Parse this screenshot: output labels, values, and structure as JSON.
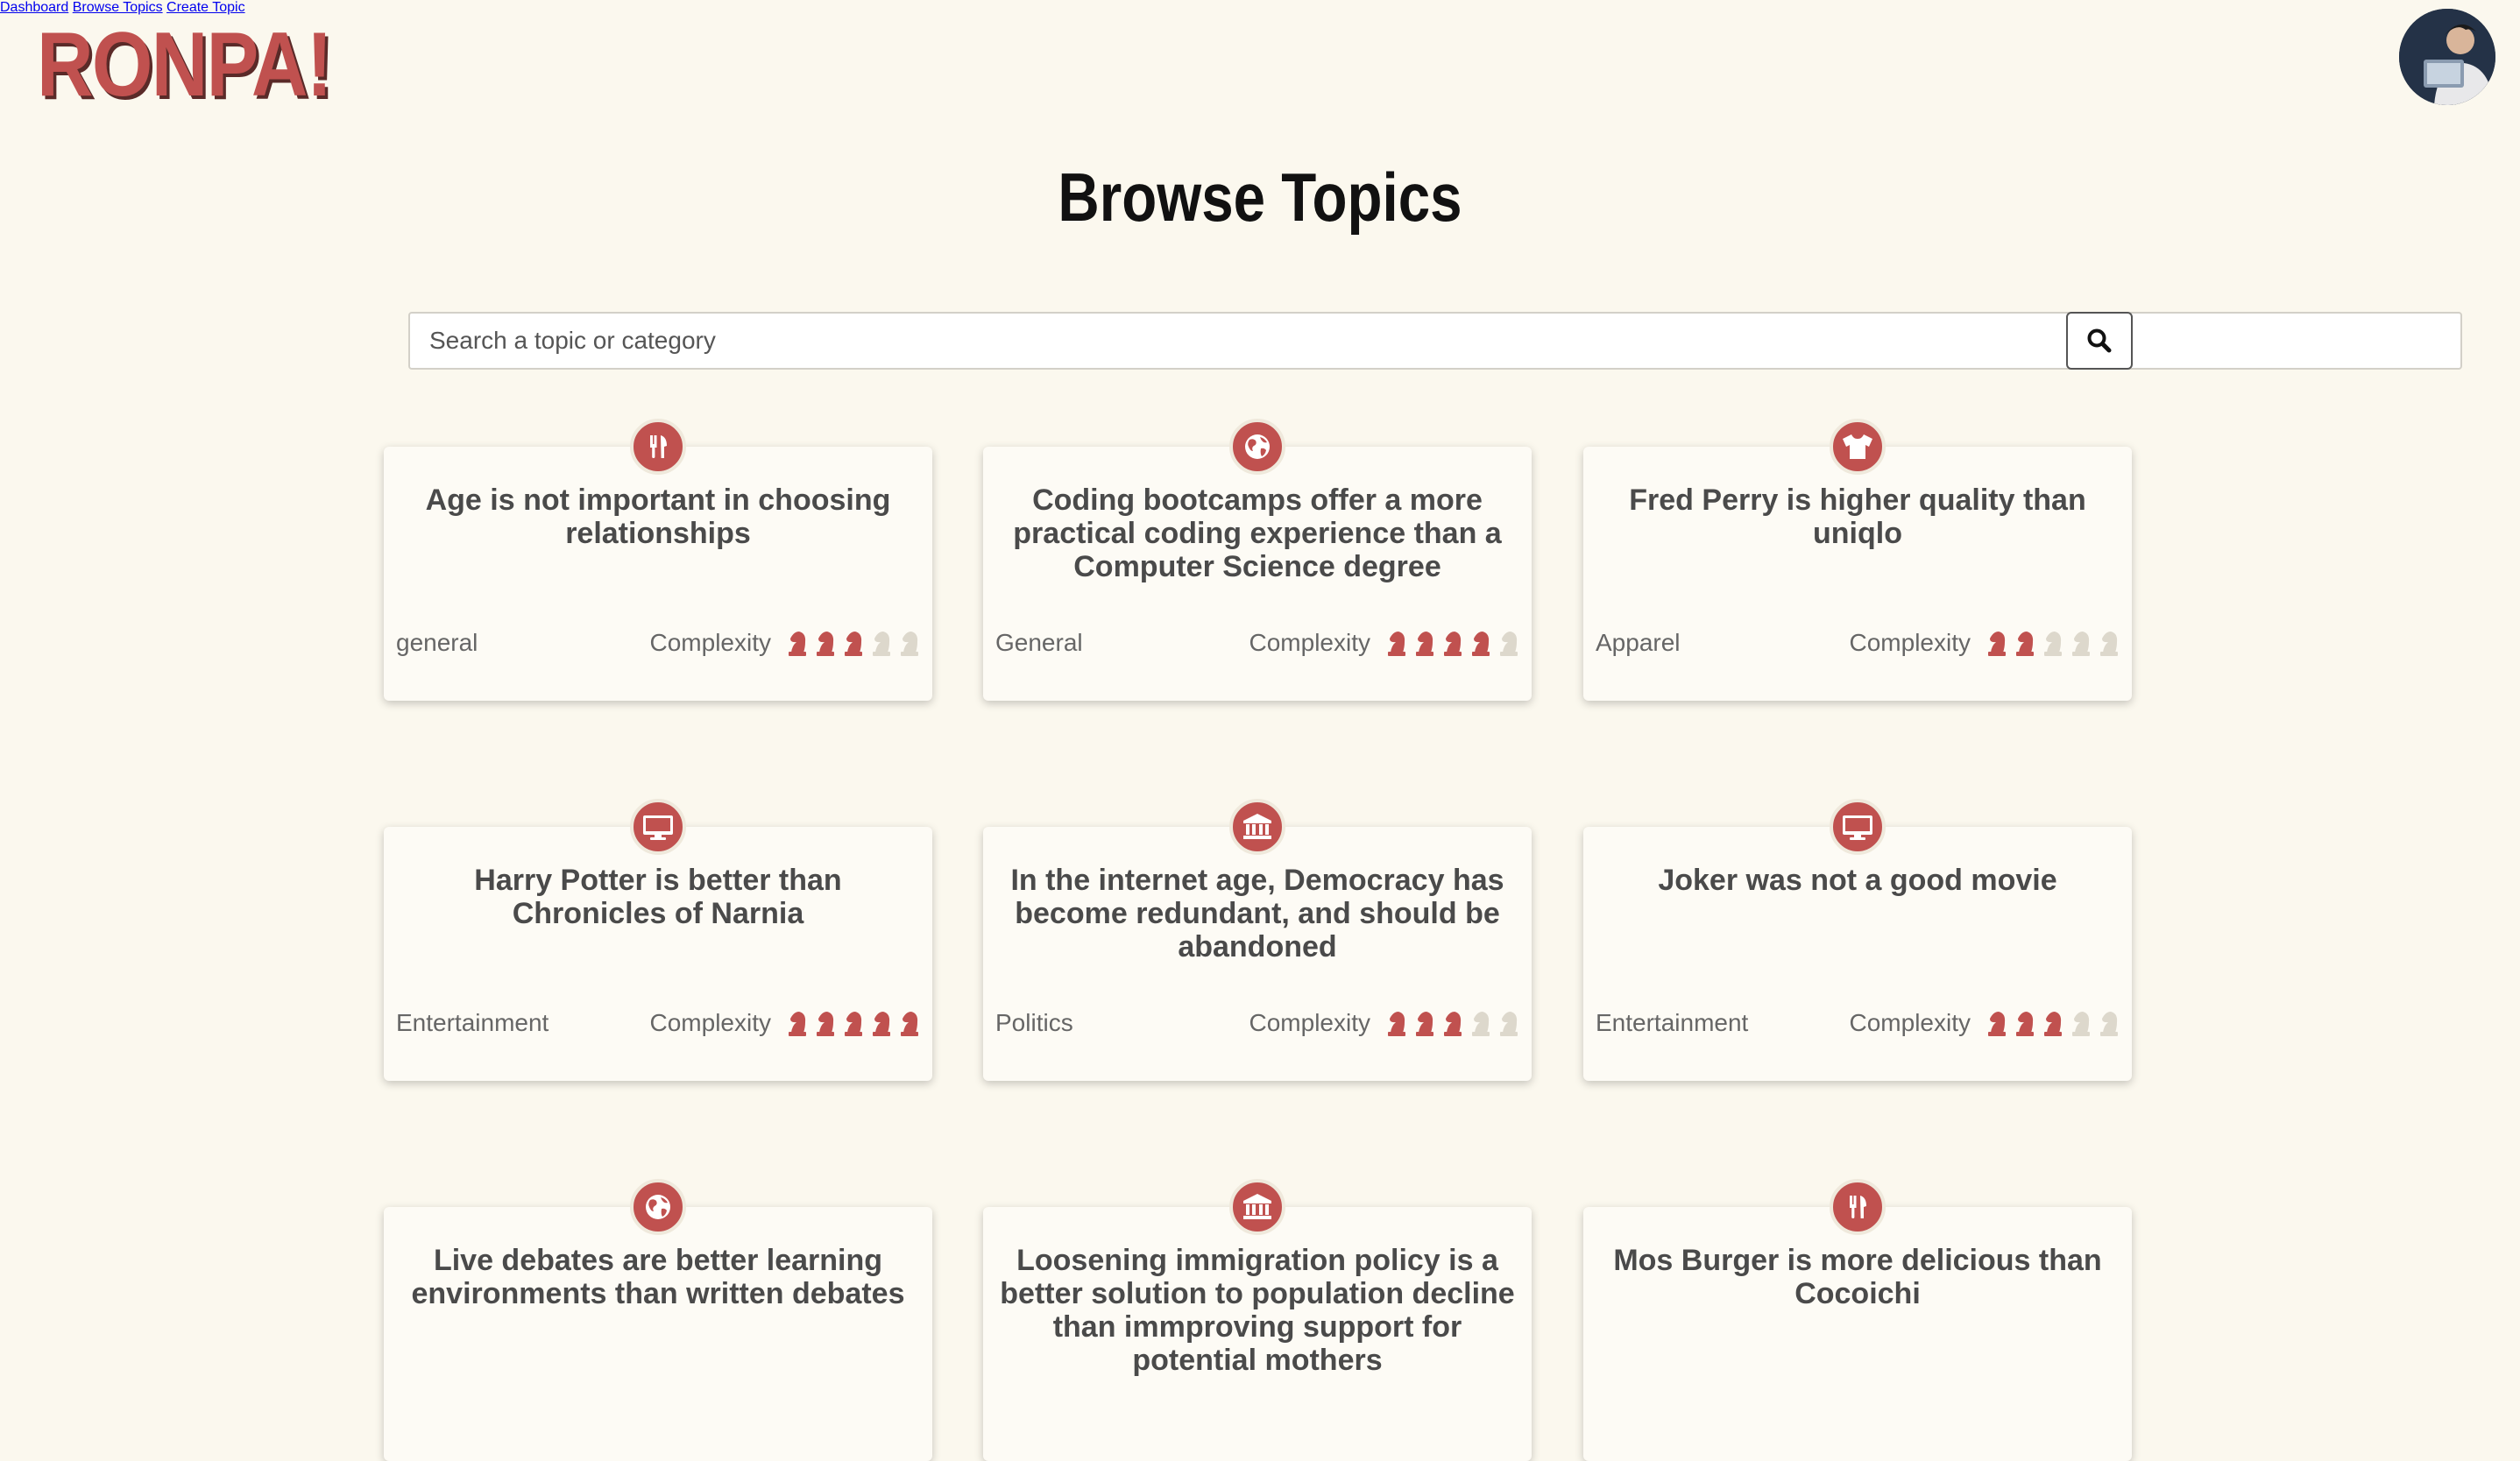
{
  "brand": {
    "name": "RONPA!"
  },
  "nav": {
    "dashboard": "Dashboard",
    "browse": "Browse Topics",
    "create": "Create Topic"
  },
  "page": {
    "title": "Browse Topics"
  },
  "search": {
    "placeholder": "Search a topic or category"
  },
  "complexity_label": "Complexity",
  "colors": {
    "accent": "#c0514f",
    "piece_off": "#ddd8cc",
    "background": "#fbf8ee"
  },
  "topics": [
    {
      "title": "Age is not important in choosing relationships",
      "category": "general",
      "complexity": 3,
      "icon": "utensils-icon"
    },
    {
      "title": "Coding bootcamps offer a more practical coding experience than a Computer Science degree",
      "category": "General",
      "complexity": 4,
      "icon": "globe-icon"
    },
    {
      "title": "Fred Perry is higher quality than uniqlo",
      "category": "Apparel",
      "complexity": 2,
      "icon": "tshirt-icon"
    },
    {
      "title": "Harry Potter is better than Chronicles of Narnia",
      "category": "Entertainment",
      "complexity": 5,
      "icon": "monitor-icon"
    },
    {
      "title": "In the internet age, Democracy has become redundant, and should be abandoned",
      "category": "Politics",
      "complexity": 3,
      "icon": "government-icon"
    },
    {
      "title": "Joker was not a good movie",
      "category": "Entertainment",
      "complexity": 3,
      "icon": "monitor-icon"
    },
    {
      "title": "Live debates are better learning environments than written debates",
      "category": "",
      "complexity": 0,
      "icon": "globe-icon"
    },
    {
      "title": "Loosening immigration policy is a better solution to population decline than immproving support for potential mothers",
      "category": "",
      "complexity": 0,
      "icon": "government-icon"
    },
    {
      "title": "Mos Burger is more delicious than Cocoichi",
      "category": "",
      "complexity": 0,
      "icon": "utensils-icon"
    }
  ]
}
